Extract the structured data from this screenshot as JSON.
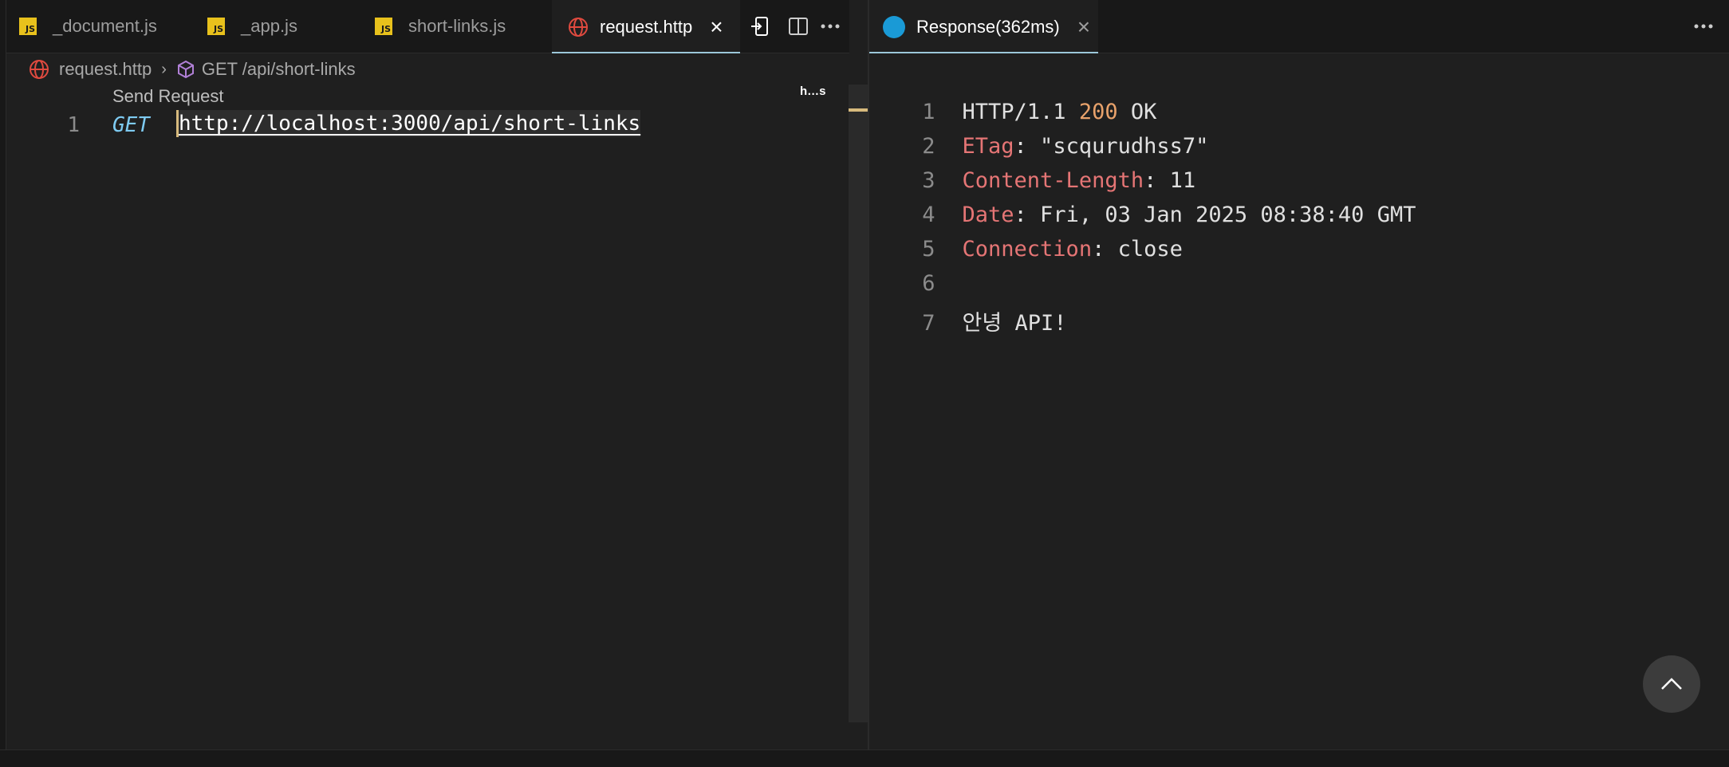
{
  "editor_tabs": [
    {
      "label": "_document.js",
      "icon": "js-file-icon"
    },
    {
      "label": "_app.js",
      "icon": "js-file-icon"
    },
    {
      "label": "short-links.js",
      "icon": "js-file-icon"
    },
    {
      "label": "request.http",
      "icon": "globe-icon",
      "active": true
    }
  ],
  "js_badge": "JS",
  "breadcrumb": {
    "file": "request.http",
    "symbol": "GET /api/short-links"
  },
  "editor": {
    "codelens": "Send Request",
    "line_number": "1",
    "method": "GET",
    "url": "http://localhost:3000/api/short-links",
    "minimap_label": "h…s"
  },
  "response_tab": {
    "label": "Response(362ms)"
  },
  "response": {
    "line1": {
      "num": "1",
      "version": "HTTP/1.1 ",
      "code": "200",
      "reason": " OK"
    },
    "line2": {
      "num": "2",
      "name": "ETag",
      "value": ": \"scqurudhss7\""
    },
    "line3": {
      "num": "3",
      "name": "Content-Length",
      "value": ": 11"
    },
    "line4": {
      "num": "4",
      "name": "Date",
      "value": ": Fri, 03 Jan 2025 08:38:40 GMT"
    },
    "line5": {
      "num": "5",
      "name": "Connection",
      "value": ": close"
    },
    "line6": {
      "num": "6"
    },
    "line7": {
      "num": "7",
      "body": "안녕 API!"
    }
  },
  "colors": {
    "accent": "#9cc7d9",
    "js_icon": "#e8c11c",
    "header_name": "#e57575",
    "status_code": "#e8a26b",
    "method": "#7ecbf2"
  }
}
